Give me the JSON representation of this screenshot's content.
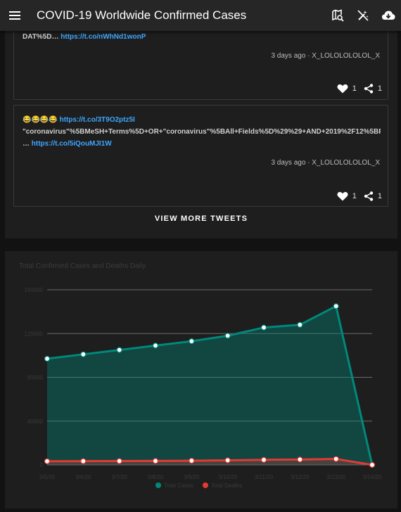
{
  "appbar": {
    "title": "COVID-19 Worldwide Confirmed Cases",
    "icons": [
      "menu-icon",
      "map-search-icon",
      "magic-wand-off-icon",
      "cloud-download-icon"
    ]
  },
  "tweets": [
    {
      "line1_text": "DAT%5D…",
      "line1_link": "https://t.co/nWhNd1wonP",
      "meta": "3 days ago · X_LOLOLOLOLOL_X",
      "likes": "1",
      "shares": "1"
    },
    {
      "emoji": "😂😂😂😂",
      "link1": "https://t.co/3T9O2ptz5I",
      "line2": "\"coronavirus\"%5BMeSH+Terms%5D+OR+\"coronavirus\"%5BAll+Fields%5D%29%29+AND+2019%2F12%5BP",
      "line3_prefix": "…",
      "link2": "https://t.co/5iQouMJI1W",
      "meta": "3 days ago · X_LOLOLOLOLOL_X",
      "likes": "1",
      "shares": "1"
    }
  ],
  "view_more_label": "VIEW MORE TWEETS",
  "colors": {
    "cases": "#00897b",
    "deaths": "#e53935",
    "link": "#3ea6ff"
  },
  "chart_data": {
    "type": "area",
    "title": "Total Confirmed Cases and Deaths Daily",
    "categories": [
      "3/5/20",
      "3/6/20",
      "3/7/20",
      "3/8/20",
      "3/9/20",
      "3/10/20",
      "3/11/20",
      "3/12/20",
      "3/13/20",
      "3/14/20"
    ],
    "yticks": [
      "0",
      "40000",
      "80000",
      "120000",
      "160000"
    ],
    "ylim": [
      0,
      160000
    ],
    "series": [
      {
        "name": "Total Cases",
        "color": "#00897b",
        "values": [
          97000,
          101000,
          105000,
          109000,
          113000,
          118000,
          125500,
          128000,
          145000,
          0
        ]
      },
      {
        "name": "Total Deaths",
        "color": "#e53935",
        "values": [
          3300,
          3400,
          3500,
          3600,
          3800,
          4200,
          4600,
          4900,
          5400,
          0
        ]
      }
    ],
    "legend_position": "bottom",
    "grid": true
  }
}
